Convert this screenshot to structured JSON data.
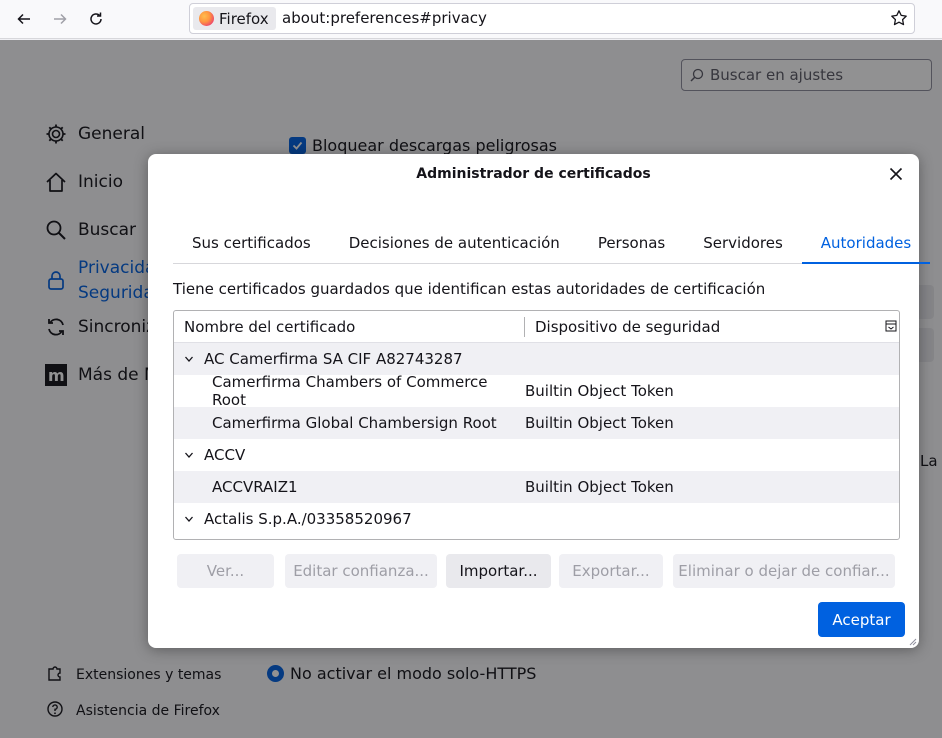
{
  "browser": {
    "identity_label": "Firefox",
    "url": "about:preferences#privacy"
  },
  "settings": {
    "search_placeholder": "Buscar en ajustes",
    "categories": {
      "general": "General",
      "home": "Inicio",
      "search": "Buscar",
      "privacy_line1": "Privacidad",
      "privacy_line2": "Seguridad",
      "sync": "Sincronizar",
      "more": "Más de Mozilla"
    },
    "footer": {
      "extensions": "Extensiones y temas",
      "support": "Asistencia de Firefox"
    },
    "block_downloads": "Bloquear descargas peligrosas",
    "https_mode": "No activar el modo solo-HTTPS",
    "partial_text": "La"
  },
  "dialog": {
    "title": "Administrador de certificados",
    "tabs": [
      "Sus certificados",
      "Decisiones de autenticación",
      "Personas",
      "Servidores",
      "Autoridades"
    ],
    "active_tab": 4,
    "description": "Tiene certificados guardados que identifican estas autoridades de certificación",
    "columns": {
      "name": "Nombre del certificado",
      "device": "Dispositivo de seguridad"
    },
    "rows": [
      {
        "name": "AC Camerfirma SA CIF A82743287",
        "device": ""
      },
      {
        "name": "Camerfirma Chambers of Commerce Root",
        "device": "Builtin Object Token"
      },
      {
        "name": "Camerfirma Global Chambersign Root",
        "device": "Builtin Object Token"
      },
      {
        "name": "ACCV",
        "device": ""
      },
      {
        "name": "ACCVRAIZ1",
        "device": "Builtin Object Token"
      },
      {
        "name": "Actalis S.p.A./03358520967",
        "device": ""
      }
    ],
    "buttons": {
      "view": "Ver...",
      "edit": "Editar confianza...",
      "import": "Importar...",
      "export": "Exportar...",
      "delete": "Eliminar o dejar de confiar..."
    },
    "accept": "Aceptar"
  },
  "colors": {
    "accent": "#0061e0",
    "overlay": "rgba(12,12,13,0.45)"
  }
}
